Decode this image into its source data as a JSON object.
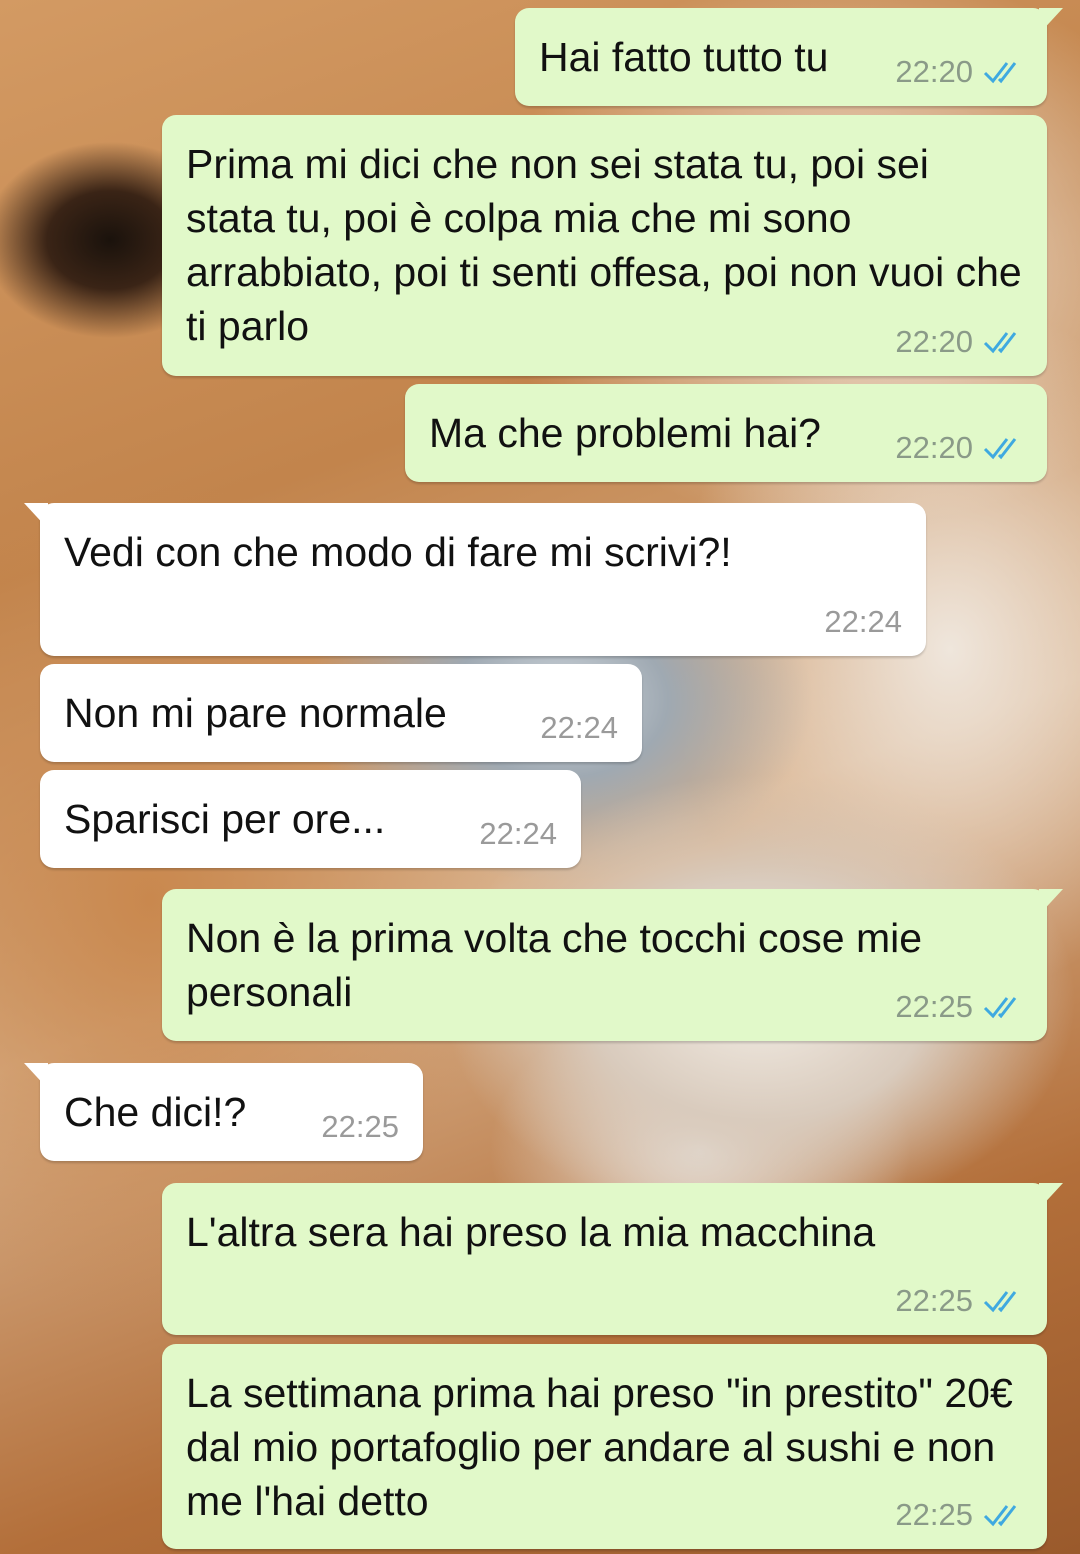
{
  "messages": [
    {
      "dir": "out",
      "text": "Hai fatto tutto tu",
      "time": "22:20",
      "status": "read"
    },
    {
      "dir": "out",
      "text": "Prima mi dici che non sei stata tu, poi sei stata tu, poi è colpa mia che mi sono arrabbiato, poi ti senti offesa, poi non vuoi che ti parlo",
      "time": "22:20",
      "status": "read"
    },
    {
      "dir": "out",
      "text": "Ma che problemi hai?",
      "time": "22:20",
      "status": "read"
    },
    {
      "dir": "in",
      "text": "Vedi con che modo di fare mi scrivi?!",
      "time": "22:24"
    },
    {
      "dir": "in",
      "text": "Non mi pare normale",
      "time": "22:24"
    },
    {
      "dir": "in",
      "text": "Sparisci per ore...",
      "time": "22:24"
    },
    {
      "dir": "out",
      "text": "Non è la prima volta che tocchi cose mie personali",
      "time": "22:25",
      "status": "read"
    },
    {
      "dir": "in",
      "text": "Che dici!?",
      "time": "22:25"
    },
    {
      "dir": "out",
      "text": "L'altra sera hai preso la mia macchina",
      "time": "22:25",
      "status": "read"
    },
    {
      "dir": "out",
      "text": "La settimana prima hai preso \"in prestito\" 20€ dal mio portafoglio per andare al sushi e non me l'hai detto",
      "time": "22:25",
      "status": "read"
    }
  ],
  "colors": {
    "outgoing_bubble": "#e1f9c9",
    "incoming_bubble": "#ffffff",
    "read_tick": "#3fa9e0",
    "timestamp": "#8a9a88"
  },
  "icons": {
    "read_receipt": "double-check-icon"
  }
}
